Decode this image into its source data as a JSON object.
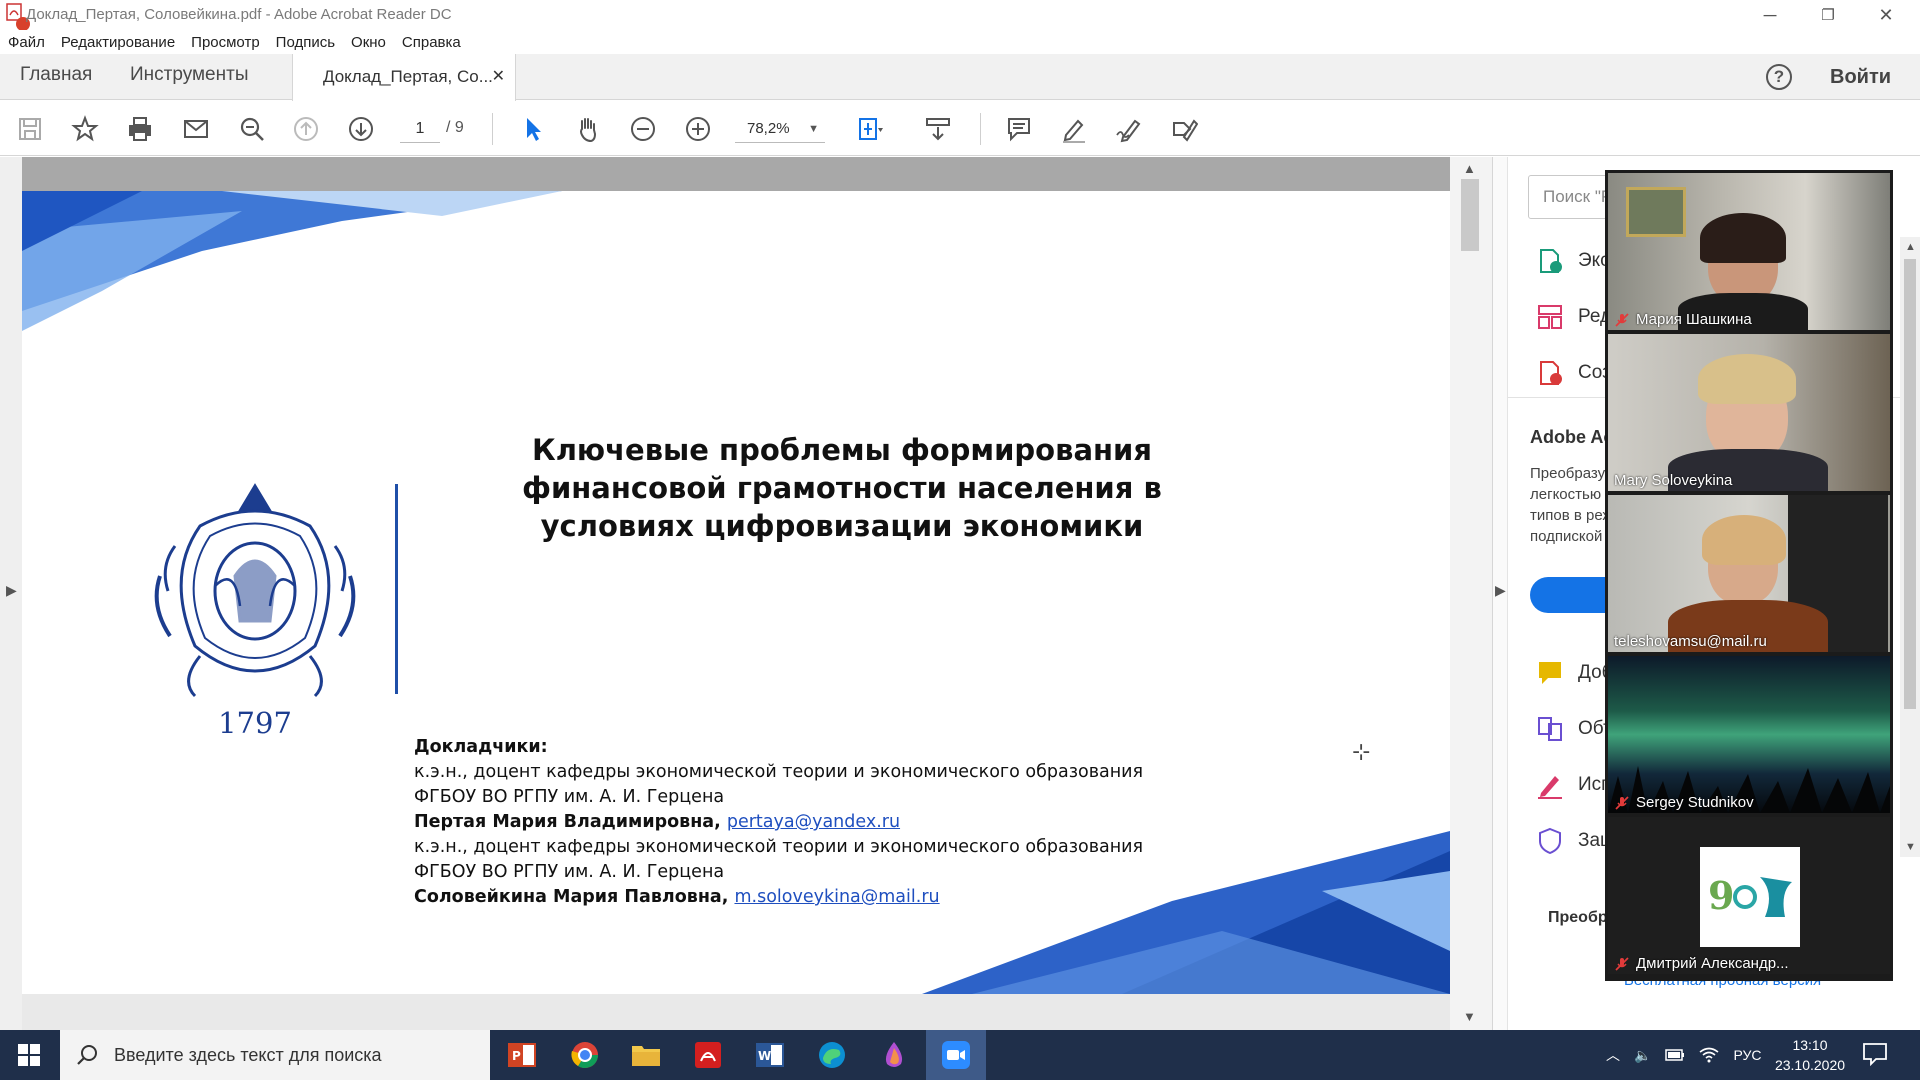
{
  "window": {
    "title": "Доклад_Пертая, Соловейкина.pdf - Adobe Acrobat Reader DC",
    "minimize": "─",
    "restore": "❐",
    "close": "✕"
  },
  "menu": [
    "Файл",
    "Редактирование",
    "Просмотр",
    "Подпись",
    "Окно",
    "Справка"
  ],
  "tabs": {
    "home": "Главная",
    "tools": "Инструменты",
    "document": "Доклад_Пертая, Со...",
    "close": "✕",
    "help": "?",
    "signin": "Войти"
  },
  "toolbar": {
    "page_current": "1",
    "page_total": "/ 9",
    "zoom": "78,2%",
    "zoom_caret": "▼"
  },
  "slide": {
    "title": "Ключевые проблемы формирования финансовой грамотности населения в условиях цифровизации экономики",
    "year": "1797",
    "speakers_label": "Докладчики:",
    "author1_position": "к.э.н., доцент кафедры экономической теории и экономического образования",
    "author1_org": "ФГБОУ ВО РГПУ им. А. И. Герцена",
    "author1_name": "Пертая Мария Владимировна, ",
    "author1_email": "pertaya@yandex.ru",
    "author2_position": "к.э.н., доцент кафедры экономической теории и экономического образования",
    "author2_org": "ФГБОУ ВО РГПУ им. А. И. Герцена",
    "author2_name": "Соловейкина Мария Павловна, ",
    "author2_email": "m.soloveykina@mail.ru"
  },
  "right_panel": {
    "search_placeholder": "Поиск \"Ра",
    "tools": [
      "Эксп",
      "Реда",
      "Созд",
      "Доб",
      "Объ",
      "Исп",
      "Защ"
    ],
    "promo_title": "Adobe Acro",
    "promo_text": "Преобразуй легкостью о типов в реж подпиской",
    "footer": "Преобра",
    "trial_link": "Бесплатная пробная версия"
  },
  "participants": [
    {
      "name": "Мария Шашкина",
      "muted": true,
      "active": false
    },
    {
      "name": "Mary Soloveykina",
      "muted": false,
      "active": true
    },
    {
      "name": "teleshovamsu@mail.ru",
      "muted": false,
      "active": false
    },
    {
      "name": "Sergey Studnikov",
      "muted": true,
      "active": false
    },
    {
      "name": "Дмитрий Александр...",
      "muted": true,
      "active": false
    }
  ],
  "taskbar": {
    "search_placeholder": "Введите здесь текст для поиска",
    "tray_lang": "РУС",
    "time": "13:10",
    "date": "23.10.2020"
  },
  "colors": {
    "accent_blue": "#1473e6",
    "slide_blue": "#1f4fa8",
    "taskbar": "#1f2f4a",
    "active_speaker": "#7ec242"
  }
}
